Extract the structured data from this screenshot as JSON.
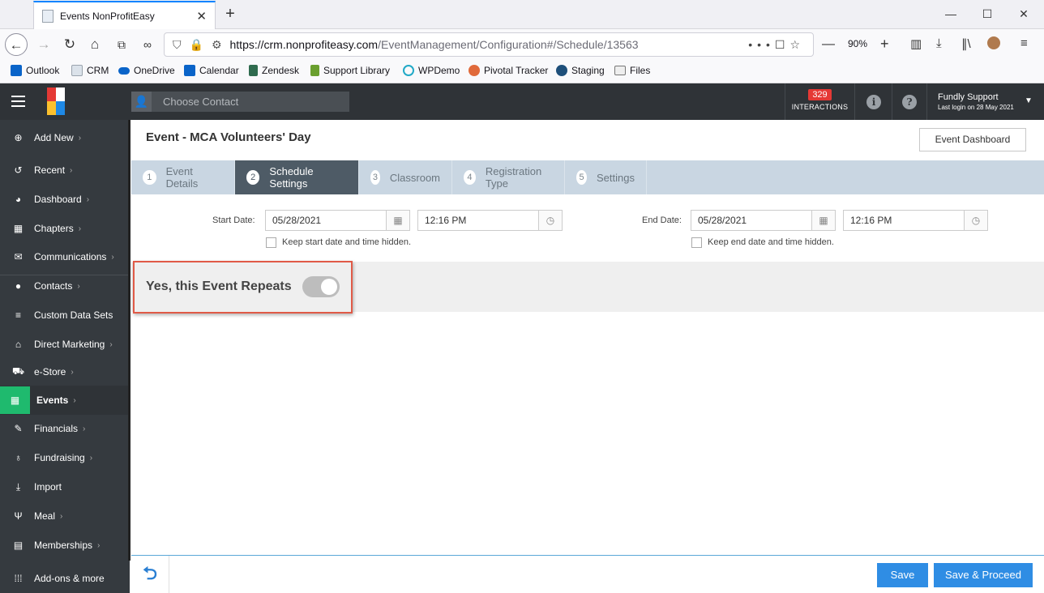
{
  "browser": {
    "tab_title": "Events NonProfitEasy",
    "url_host": "https://crm.nonprofiteasy.com",
    "url_path": "/EventManagement/Configuration#/Schedule/13563",
    "zoom": "90%"
  },
  "bookmarks": [
    {
      "label": "Outlook",
      "icon": "outlook-icon",
      "color": "#0a64c9"
    },
    {
      "label": "CRM",
      "icon": "page-icon",
      "color": "#b8c2cc"
    },
    {
      "label": "OneDrive",
      "icon": "cloud-icon",
      "color": "#0a64c9"
    },
    {
      "label": "Calendar",
      "icon": "outlook-icon",
      "color": "#0a64c9"
    },
    {
      "label": "Zendesk",
      "icon": "zendesk-icon",
      "color": "#2f6b4f"
    },
    {
      "label": "Support Library",
      "icon": "zendesk-icon",
      "color": "#6a9f2f"
    },
    {
      "label": "WPDemo",
      "icon": "wp-icon",
      "color": "#21a9c7"
    },
    {
      "label": "Pivotal Tracker",
      "icon": "pivotal-icon",
      "color": "#e06a3b"
    },
    {
      "label": "Staging",
      "icon": "staging-icon",
      "color": "#1e4f7a"
    },
    {
      "label": "Files",
      "icon": "folder-icon",
      "color": "#777777"
    }
  ],
  "header": {
    "contact_placeholder": "Choose Contact",
    "interactions_count": "329",
    "interactions_label": "INTERACTIONS",
    "user_name": "Fundly Support",
    "last_login": "Last login on 28 May 2021"
  },
  "sidebar": {
    "items": [
      {
        "label": "Add New",
        "icon": "plus-circle-icon",
        "chevron": true
      },
      {
        "label": "Recent",
        "icon": "history-icon",
        "chevron": true
      },
      {
        "label": "Dashboard",
        "icon": "dashboard-icon",
        "chevron": true
      },
      {
        "label": "Chapters",
        "icon": "grid-icon",
        "chevron": true
      },
      {
        "label": "Communications",
        "icon": "envelope-icon",
        "chevron": true
      },
      {
        "label": "Contacts",
        "icon": "person-icon",
        "chevron": true
      },
      {
        "label": "Custom Data Sets",
        "icon": "database-icon",
        "chevron": false
      },
      {
        "label": "Direct Marketing",
        "icon": "bank-icon",
        "chevron": true
      },
      {
        "label": "e-Store",
        "icon": "cart-icon",
        "chevron": true
      },
      {
        "label": "Events",
        "icon": "calendar-icon",
        "chevron": true,
        "active": true
      },
      {
        "label": "Financials",
        "icon": "ticket-icon",
        "chevron": true
      },
      {
        "label": "Fundraising",
        "icon": "moneybag-icon",
        "chevron": true
      },
      {
        "label": "Import",
        "icon": "import-icon",
        "chevron": false
      },
      {
        "label": "Meal",
        "icon": "utensils-icon",
        "chevron": true
      },
      {
        "label": "Memberships",
        "icon": "id-card-icon",
        "chevron": true
      },
      {
        "label": "Add-ons & more",
        "icon": "apps-icon",
        "chevron": false
      }
    ]
  },
  "page": {
    "title": "Event - MCA Volunteers' Day",
    "dashboard_button": "Event Dashboard",
    "steps": [
      {
        "num": "1",
        "label": "Event Details"
      },
      {
        "num": "2",
        "label": "Schedule Settings",
        "active": true
      },
      {
        "num": "3",
        "label": "Classroom"
      },
      {
        "num": "4",
        "label": "Registration Type"
      },
      {
        "num": "5",
        "label": "Settings"
      }
    ],
    "start_label": "Start Date:",
    "start_date": "05/28/2021",
    "start_time": "12:16 PM",
    "start_hidden_label": "Keep start date and time hidden.",
    "end_label": "End Date:",
    "end_date": "05/28/2021",
    "end_time": "12:16 PM",
    "end_hidden_label": "Keep end date and time hidden.",
    "repeat_label": "Yes, this Event Repeats",
    "repeat_enabled": false
  },
  "footer": {
    "save": "Save",
    "save_proceed": "Save & Proceed"
  },
  "colors": {
    "accent_green": "#1fba6e",
    "primary_blue": "#2f8de4",
    "highlight_red": "#e05a47",
    "header_dark": "#2f3337"
  }
}
